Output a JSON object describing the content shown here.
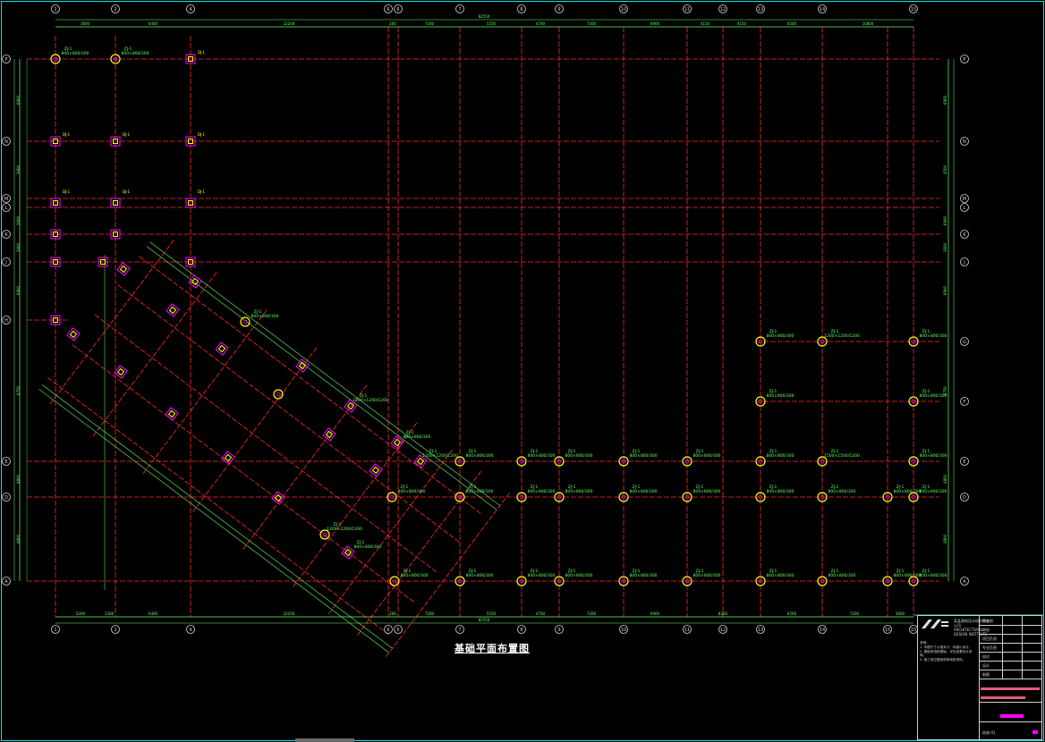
{
  "drawing": {
    "title": "基础平面布置图",
    "frame_color": "#00e5e5",
    "colors": {
      "axis": "#ff2a2a",
      "dim": "#66ff66",
      "column_outer": "#ffff00",
      "column_inner": "#ff00ff",
      "label": "#66ff66",
      "bubble": "#d8d8d8"
    },
    "top_axes": [
      "1",
      "2",
      "4",
      "6",
      "6",
      "7",
      "8",
      "9",
      "10",
      "11",
      "12",
      "13",
      "14",
      "15"
    ],
    "bottom_axes": [
      "1",
      "2",
      "4",
      "6",
      "6",
      "7",
      "8",
      "9",
      "10",
      "11",
      "12",
      "13",
      "14",
      "15",
      "15"
    ],
    "left_axes": [
      "P",
      "N",
      "M",
      "L",
      "K",
      "J",
      "H",
      "E",
      "D",
      "A"
    ],
    "right_axes": [
      "P",
      "N",
      "M",
      "L",
      "K",
      "J",
      "G",
      "F",
      "E",
      "D",
      "A"
    ],
    "top_dims": [
      "3600",
      "6400",
      "22200",
      "200",
      "7200",
      "5550",
      "4700",
      "7200",
      "6900",
      "4150",
      "4150",
      "6500",
      "10800"
    ],
    "top_total": "82550",
    "bottom_dims": [
      "5200",
      "1200",
      "6400",
      "22200",
      "200",
      "7200",
      "5550",
      "4700",
      "7200",
      "6900",
      "8300",
      "6500",
      "7200",
      "3600"
    ],
    "bottom_total": "82550",
    "left_dims": [
      "6900",
      "3900",
      "3000",
      "3600",
      "6900",
      "6750",
      "4800",
      "4800"
    ],
    "right_dims": [
      "6900",
      "4500",
      "6900",
      "3600",
      "6900",
      "6750",
      "4800",
      "4800"
    ],
    "pile_label_a": "ZJ-1",
    "pile_label_b": "ZJ-2",
    "pile_spec_a": "800×800/300",
    "pile_spec_b": "1200×1200/1200",
    "pile_spec_c": "1500×1500/1200",
    "grid_label_small": "DJ-1"
  },
  "title_block": {
    "company": "某某建筑设计研究院有限公司",
    "company_en": "ARCHITECTURAL DESIGN INSTITUTE",
    "notes": [
      "说明：",
      "1. 本图尺寸以毫米计，标高以米计。",
      "2. 基础采用桩基础，详见桩基设计说明。",
      "3. 施工前应复核现场地质资料。"
    ],
    "rows": [
      "审定",
      "审核",
      "项目负责",
      "专业负责",
      "校对",
      "设计",
      "制图"
    ],
    "drawing_no": "结施-01"
  }
}
